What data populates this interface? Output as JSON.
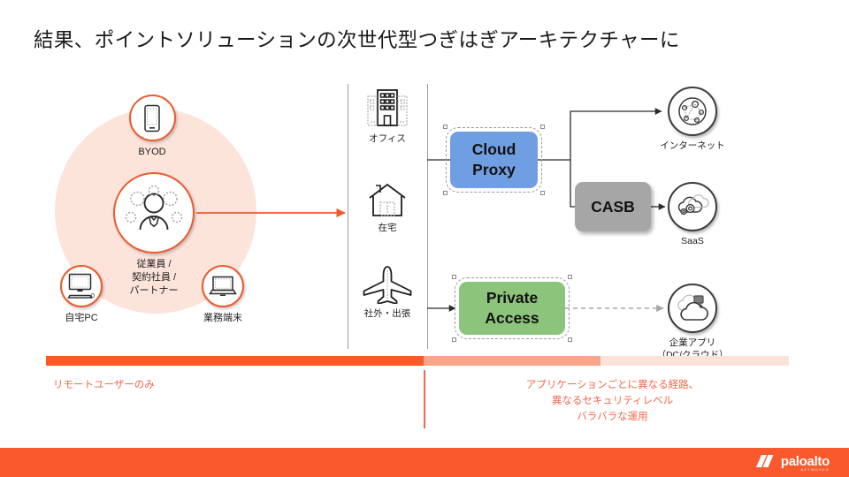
{
  "slide": {
    "title": "結果、ポイントソリューションの次世代型つぎはぎアーキテクチャーに"
  },
  "users": {
    "byod": {
      "label": "BYOD",
      "icon": "mobile-phone-icon"
    },
    "employee": {
      "label": "従業員 /\n契約社員 /\nパートナー",
      "line1": "従業員 /",
      "line2": "契約社員 /",
      "line3": "パートナー",
      "icon": "user-group-icon"
    },
    "home_pc": {
      "label": "自宅PC",
      "icon": "desktop-computer-icon"
    },
    "work_device": {
      "label": "業務端末",
      "icon": "laptop-icon"
    }
  },
  "locations": [
    {
      "label": "オフィス",
      "icon": "office-building-icon"
    },
    {
      "label": "在宅",
      "icon": "house-icon"
    },
    {
      "label": "社外・出張",
      "icon": "airplane-icon"
    }
  ],
  "services": {
    "cloud_proxy": {
      "line1": "Cloud",
      "line2": "Proxy",
      "color": "#6f9fe2"
    },
    "casb": {
      "label": "CASB",
      "color": "#a6a6a6"
    },
    "private_access": {
      "line1": "Private",
      "line2": "Access",
      "color": "#8dc47c"
    }
  },
  "destinations": [
    {
      "label": "インターネット",
      "icon": "internet-network-icon"
    },
    {
      "label": "SaaS",
      "icon": "saas-cloud-icon"
    },
    {
      "label": "企業アプリ",
      "label2": "（DC/クラウド）",
      "icon": "enterprise-app-cloud-icon"
    }
  ],
  "bottom": {
    "left_caption": "リモートユーザーのみ",
    "right_caption_line1": "アプリケーションごとに異なる経路、",
    "right_caption_line2": "異なるセキュリティレベル",
    "right_caption_line3": "バラバラな運用",
    "bar_colors": [
      "#f95a27",
      "#f9a68c",
      "#fce3da"
    ]
  },
  "footer": {
    "brand": "paloalto",
    "brand_sub": "NETWORKS",
    "bg_color": "#fa582d"
  }
}
